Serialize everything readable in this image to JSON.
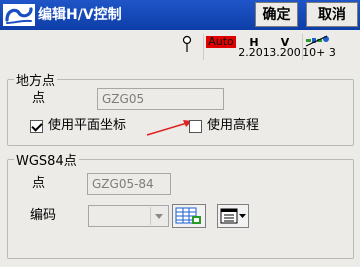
{
  "title": "编辑H/V控制",
  "buttons": {
    "ok": "确定",
    "cancel": "取消"
  },
  "status": {
    "auto": "Auto",
    "h_label": "H",
    "h_value": "2.201",
    "v_label": "V",
    "v_value": "3.200",
    "sats": "10+ 3"
  },
  "local_point": {
    "legend": "地方点",
    "point_label": "点",
    "point_value": "GZG05",
    "use_plane_coords": {
      "label": "使用平面坐标",
      "checked": true
    },
    "use_elevation": {
      "label": "使用高程",
      "checked": false
    }
  },
  "wgs84_point": {
    "legend": "WGS84点",
    "point_label": "点",
    "point_value": "GZG05-84",
    "code_label": "编码",
    "code_value": ""
  },
  "colors": {
    "titlebar": "#1a4fc2",
    "auto_badge": "#e00000",
    "annotation_arrow": "#e02020"
  },
  "icons": [
    "app-logo-icon",
    "pin-icon",
    "satellite-icon",
    "table-list-icon",
    "menu-dropdown-icon"
  ]
}
